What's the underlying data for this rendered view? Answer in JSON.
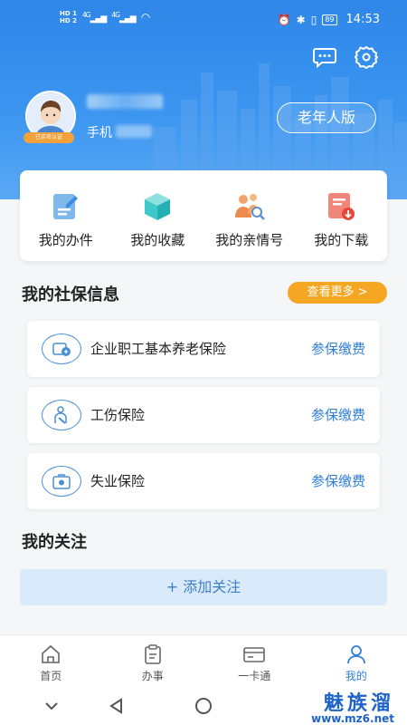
{
  "status_bar": {
    "hd1": "HD 1",
    "hd2": "HD 2",
    "net1": "4G",
    "net2": "4G",
    "battery": "89",
    "time": "14:53"
  },
  "header": {
    "verified_badge": "已实名认证",
    "phone_prefix": "手机",
    "elder_mode_button": "老年人版",
    "icons": [
      "chat-bubble-icon",
      "gear-icon"
    ]
  },
  "quick_actions": [
    {
      "label": "我的办件",
      "icon": "edit-doc-icon"
    },
    {
      "label": "我的收藏",
      "icon": "cube-icon"
    },
    {
      "label": "我的亲情号",
      "icon": "family-search-icon"
    },
    {
      "label": "我的下载",
      "icon": "download-doc-icon"
    }
  ],
  "social_insurance": {
    "title": "我的社保信息",
    "more_button": "查看更多 >",
    "items": [
      {
        "name": "企业职工基本养老保险",
        "action": "参保缴费",
        "icon": "pension-icon"
      },
      {
        "name": "工伤保险",
        "action": "参保缴费",
        "icon": "injury-icon"
      },
      {
        "name": "失业保险",
        "action": "参保缴费",
        "icon": "unemployment-icon"
      }
    ]
  },
  "follow": {
    "title": "我的关注",
    "add_button": "+ 添加关注"
  },
  "tabbar": [
    {
      "label": "首页",
      "icon": "home-icon"
    },
    {
      "label": "办事",
      "icon": "clipboard-icon"
    },
    {
      "label": "一卡通",
      "icon": "card-icon"
    },
    {
      "label": "我的",
      "icon": "person-icon",
      "active": true
    }
  ],
  "watermark": {
    "brand": "魅族溜",
    "url": "www.mz6.net"
  },
  "colors": {
    "primary": "#2f86e8",
    "accent": "#f5a623",
    "link": "#2f7ed8"
  }
}
